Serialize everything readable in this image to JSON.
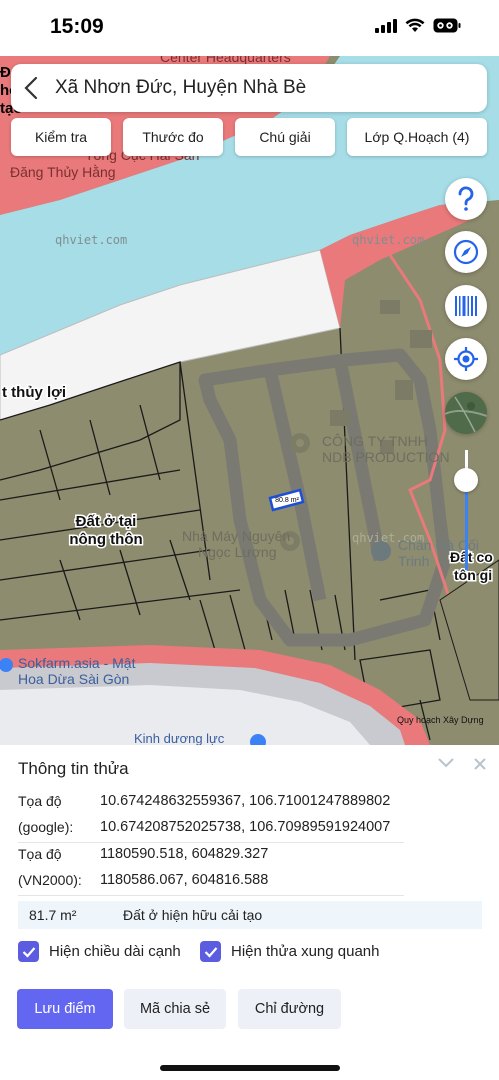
{
  "status": {
    "time": "15:09"
  },
  "header": {
    "title": "Xã Nhơn Đức, Huyện Nhà Bè"
  },
  "map_buttons": [
    "Kiểm tra",
    "Thước đo",
    "Chú giải",
    "Lớp Q.Hoạch (4)"
  ],
  "map": {
    "labels": {
      "land_rural": "Đất ở tại nông thôn",
      "land_rural_l1": "Đất ở tại",
      "land_rural_l2": "nông thôn",
      "irrigation": "t thủy lợi",
      "watermark1": "qhviet.com",
      "watermark2": "qhviet.com",
      "watermark3": "qhviet.com",
      "company_l1": "CÔNG TY TNHH",
      "company_l2": "NDB PRODUCTION",
      "factory_l1": "Nhà Máy Nguyên",
      "factory_l2": "Ngọc Lượng",
      "chicken": "Chân Gà Cối",
      "chicken2": "Trinh",
      "right_cut1": "Đất co",
      "right_cut2": "tôn gi",
      "sokfarm_l1": "Sokfarm.asia - Mật",
      "sokfarm_l2": "Hoa Dừa Sài Gòn",
      "street": "Kinh dương lực",
      "top_cut1": "Center Headquarters",
      "top_cut2": "Tổng Cục Hải Sản",
      "top_cut3": "Đăng Thủy Hằng",
      "left_cut1": "Đ",
      "left_cut2": "hố",
      "left_cut3": "hi",
      "left_cut4": "tạo",
      "parcel_area": "80.8 m²",
      "attribution": "Quy hoạch Xây Dựng"
    }
  },
  "panel": {
    "title": "Thông tin thửa",
    "rows": [
      {
        "label": "Tọa độ",
        "value": "10.674248632559367, 106.71001247889802"
      },
      {
        "label": "(google):",
        "value": "10.674208752025738, 106.70989591924007"
      },
      {
        "label": "Tọa độ",
        "value": "1180590.518, 604829.327"
      },
      {
        "label": "(VN2000):",
        "value": "1180586.067, 604816.588"
      }
    ],
    "area": "81.7 m²",
    "area_type": "Đất ở hiện hữu cải tạo",
    "check1": "Hiện chiều dài cạnh",
    "check2": "Hiện thửa xung quanh",
    "btn_save": "Lưu điểm",
    "btn_share": "Mã chia sẻ",
    "btn_directions": "Chỉ đường"
  },
  "colors": {
    "accent": "#6366f1",
    "river": "#a6dde7",
    "land": "#8d8c6e",
    "pink": "#e9797a"
  }
}
